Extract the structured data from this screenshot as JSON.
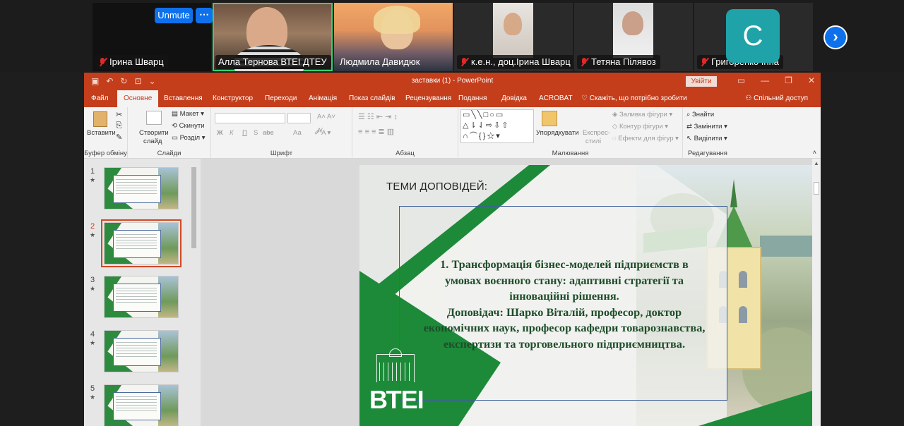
{
  "participants": [
    {
      "name": "Ірина Шварц",
      "muted": true
    },
    {
      "name": "Алла Тернова ВТЕІ ДТЕУ",
      "muted": false,
      "speaking": true
    },
    {
      "name": "Людмила Давидюк",
      "muted": false
    },
    {
      "name": "к.е.н., доц.Ірина Шварц",
      "muted": true
    },
    {
      "name": "Тетяна Пілявоз",
      "muted": true
    },
    {
      "name": "Григоренко Інна",
      "muted": true,
      "avatar_letter": "C"
    }
  ],
  "zoom": {
    "unmute_label": "Unmute",
    "more_label": "⋯",
    "next_icon": "chevron-right-icon",
    "accent": "#0e71eb"
  },
  "ppt": {
    "doc_title": "заставки (1)  -  PowerPoint",
    "signin_label": "Увійти",
    "accent": "#c43e1c",
    "tabs": [
      "Файл",
      "Основне",
      "Вставлення",
      "Конструктор",
      "Переходи",
      "Анімація",
      "Показ слайдів",
      "Рецензування",
      "Подання",
      "Довідка",
      "ACROBAT"
    ],
    "tell_me": "Скажіть, що потрібно зробити",
    "share": "Спільний доступ",
    "ribbon": {
      "clipboard": {
        "paste": "Вставити",
        "group": "Буфер обміну"
      },
      "slides": {
        "new_slide_1": "Створити",
        "new_slide_2": "слайд",
        "layout": "Макет",
        "reset": "Скинути",
        "section": "Розділ",
        "group": "Слайди"
      },
      "font": {
        "bold": "Ж",
        "italic": "К",
        "underline": "П",
        "strike": "S",
        "spacing": "abc",
        "case": "Аа",
        "group": "Шрифт"
      },
      "paragraph": {
        "group": "Абзац"
      },
      "drawing": {
        "arrange": "Упорядкувати",
        "quick_styles_1": "Експрес-",
        "quick_styles_2": "стилі",
        "fill": "Заливка фігури",
        "outline": "Контур фігури",
        "effects": "Ефекти для фігур",
        "group": "Малювання"
      },
      "editing": {
        "find": "Знайти",
        "replace": "Замінити",
        "select": "Виділити",
        "group": "Редагування"
      }
    },
    "thumbnails": [
      {
        "num": "1",
        "star": "★",
        "selected": false
      },
      {
        "num": "2",
        "star": "★",
        "selected": true
      },
      {
        "num": "3",
        "star": "★",
        "selected": false
      },
      {
        "num": "4",
        "star": "★",
        "selected": false
      },
      {
        "num": "5",
        "star": "★",
        "selected": false
      }
    ]
  },
  "slide": {
    "heading": "ТЕМИ ДОПОВІДЕЙ:",
    "body_lines": [
      "1. Трансформація бізнес-моделей підприємств в",
      "умовах воєнного стану: адаптивні стратегії та",
      "інноваційні рішення.",
      "Доповідач: Шарко Віталій, професор, доктор",
      "економічних наук, професор кафедри товарознавства,",
      "експертизи та торговельного підприємництва."
    ],
    "logo_text": "ВТЕІ",
    "brand_green": "#1d8a3a"
  }
}
